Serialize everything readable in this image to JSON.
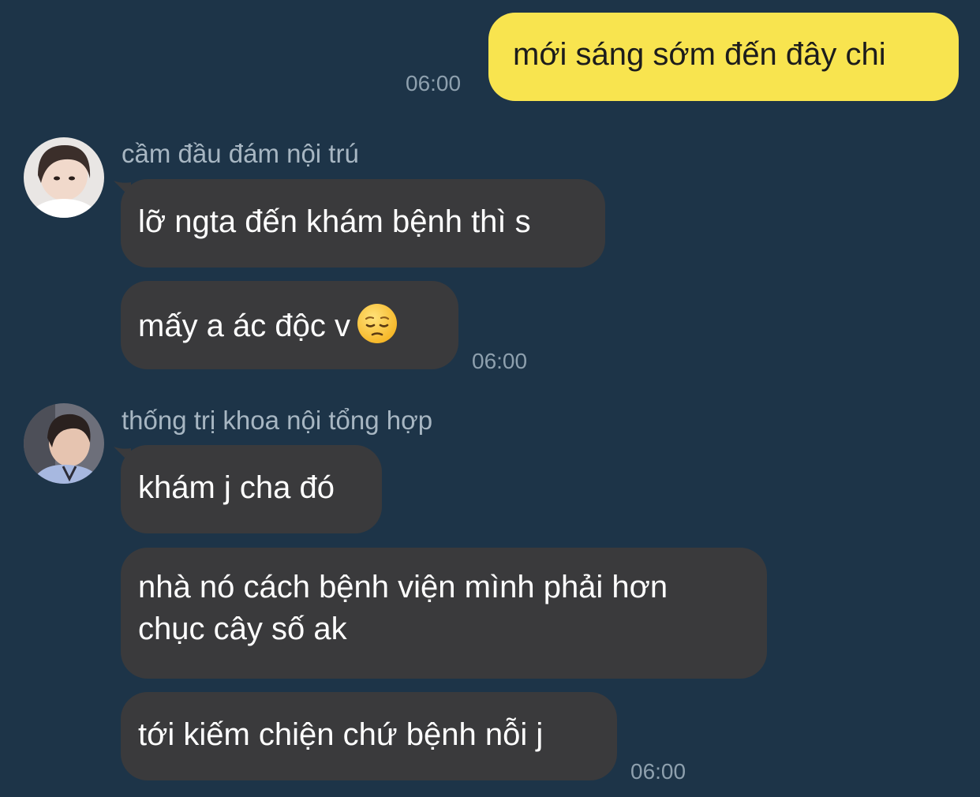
{
  "chat": {
    "messages": [
      {
        "text": "mới sáng sớm đến đây chi",
        "time": "06:00"
      },
      {
        "sender": "cầm đầu đám nội trú",
        "m1": "lỡ ngta đến khám bệnh thì s",
        "m2": "mấy a ác độc v",
        "emoji": "pensive-face-emoji",
        "time": "06:00"
      },
      {
        "sender": "thống trị khoa nội tổng hợp",
        "m1": "khám j cha đó",
        "m2_line1": "nhà nó cách bệnh viện mình phải hơn",
        "m2_line2": "chục cây số ak",
        "m3": "tới kiếm chiện chứ bệnh nỗi j",
        "time": "06:00"
      }
    ]
  },
  "colors": {
    "background": "#1d3448",
    "outgoing_bubble": "#f8e44f",
    "incoming_bubble": "#3a3a3c",
    "timestamp": "#8ea0ae",
    "sender_name": "#a7b6c2"
  }
}
